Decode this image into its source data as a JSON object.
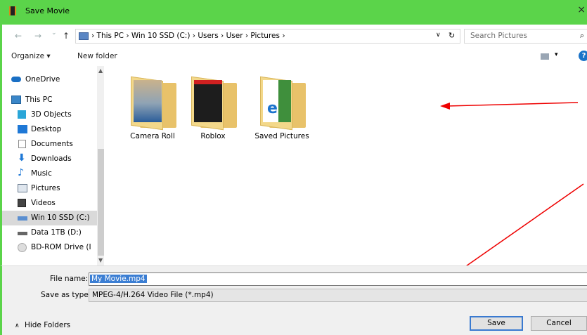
{
  "window": {
    "title": "Save Movie",
    "close": "×"
  },
  "address": {
    "back": "←",
    "forward": "→",
    "recent": "⌄",
    "up": "↑",
    "path": "›  This PC  ›  Win 10 SSD (C:)  ›  Users  ›  User  ›  Pictures  ›",
    "dropdown": "∨",
    "refresh": "↻",
    "search_placeholder": "Search Pictures",
    "search_glyph": "⌕"
  },
  "toolbar": {
    "organize": "Organize ▾",
    "new_folder": "New folder",
    "view_dropdown": "▾",
    "help": "?"
  },
  "nav": {
    "items": [
      {
        "label": "OneDrive",
        "icon": "cloud-icon",
        "color": "#1a6fc4"
      },
      {
        "label": "This PC",
        "icon": "computer-icon",
        "color": "#3a86c8"
      },
      {
        "label": "3D Objects",
        "icon": "cube-icon",
        "color": "#2aa6d8"
      },
      {
        "label": "Desktop",
        "icon": "desktop-icon",
        "color": "#1e78d6"
      },
      {
        "label": "Documents",
        "icon": "document-icon",
        "color": "#8c8c8c"
      },
      {
        "label": "Downloads",
        "icon": "download-icon",
        "color": "#1e78d6"
      },
      {
        "label": "Music",
        "icon": "music-icon",
        "color": "#1e78d6"
      },
      {
        "label": "Pictures",
        "icon": "pictures-icon",
        "color": "#6b7c8f"
      },
      {
        "label": "Videos",
        "icon": "videos-icon",
        "color": "#444"
      },
      {
        "label": "Win 10 SSD (C:)",
        "icon": "drive-icon",
        "color": "#5a8ed0"
      },
      {
        "label": "Data 1TB (D:)",
        "icon": "drive-icon",
        "color": "#666"
      },
      {
        "label": "BD-ROM Drive (I",
        "icon": "disc-icon",
        "color": "#bbb"
      }
    ],
    "scroll_up": "▲",
    "scroll_down": "▼"
  },
  "folders": [
    {
      "label": "Camera Roll"
    },
    {
      "label": "Roblox"
    },
    {
      "label": "Saved Pictures"
    }
  ],
  "form": {
    "filename_label": "File name:",
    "filename_value": "My Movie.mp4",
    "savetype_label": "Save as type:",
    "savetype_value": "MPEG-4/H.264 Video File (*.mp4)",
    "hide_folders": "Hide Folders",
    "hide_folders_chevron": "∧",
    "save": "Save",
    "cancel": "Cancel"
  },
  "colors": {
    "titlebar": "#5bd44a",
    "selection": "#3b7ed3",
    "annotation": "#e00000"
  }
}
